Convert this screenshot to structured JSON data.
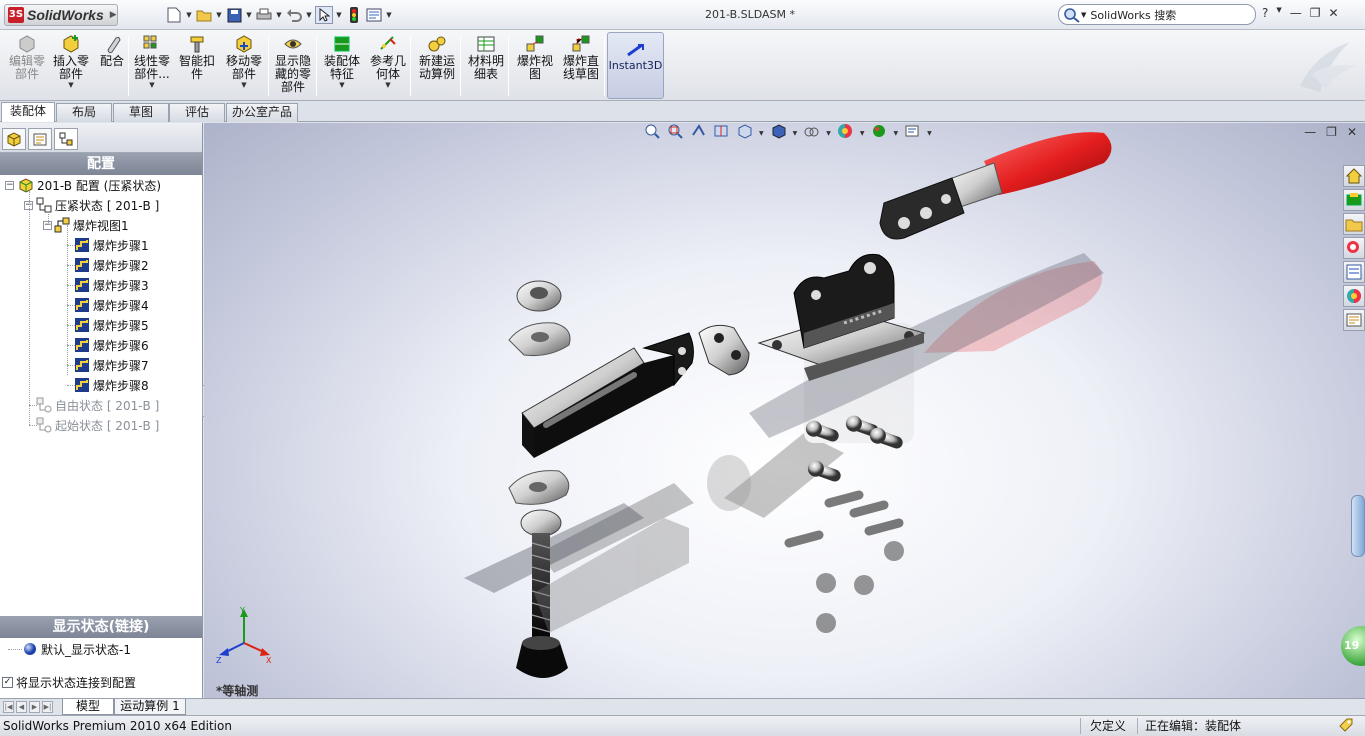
{
  "app": {
    "logo_text": "SolidWorks",
    "doc_title": "201-B.SLDASM *",
    "search_text": "SolidWorks 搜索",
    "help": "?"
  },
  "ribbon": {
    "buttons": [
      {
        "label": "编辑零\n部件"
      },
      {
        "label": "插入零\n部件"
      },
      {
        "label": "配合"
      },
      {
        "label": "线性零\n部件..."
      },
      {
        "label": "智能扣\n件"
      },
      {
        "label": "移动零\n部件"
      },
      {
        "label": "显示隐\n藏的零\n部件"
      },
      {
        "label": "装配体\n特征"
      },
      {
        "label": "参考几\n何体"
      },
      {
        "label": "新建运\n动算例"
      },
      {
        "label": "材料明\n细表"
      },
      {
        "label": "爆炸视\n图"
      },
      {
        "label": "爆炸直\n线草图"
      }
    ],
    "instant3d": "Instant3D"
  },
  "tabs": [
    "装配体",
    "布局",
    "草图",
    "评估",
    "办公室产品"
  ],
  "panel": {
    "config_header": "配置",
    "tree": [
      {
        "label": "201-B 配置  (压紧状态)",
        "level": 0
      },
      {
        "label": "压紧状态 [ 201-B ]",
        "level": 1
      },
      {
        "label": "爆炸视图1",
        "level": 2
      },
      {
        "label": "爆炸步骤1",
        "level": 3
      },
      {
        "label": "爆炸步骤2",
        "level": 3
      },
      {
        "label": "爆炸步骤3",
        "level": 3
      },
      {
        "label": "爆炸步骤4",
        "level": 3
      },
      {
        "label": "爆炸步骤5",
        "level": 3
      },
      {
        "label": "爆炸步骤6",
        "level": 3
      },
      {
        "label": "爆炸步骤7",
        "level": 3
      },
      {
        "label": "爆炸步骤8",
        "level": 3
      },
      {
        "label": "自由状态 [ 201-B ]",
        "level": 1
      },
      {
        "label": "起始状态 [ 201-B ]",
        "level": 1
      }
    ],
    "display_state_header": "显示状态(链接)",
    "display_state_item": "默认_显示状态-1",
    "link_checkbox": "将显示状态连接到配置",
    "link_checked": true
  },
  "viewport": {
    "view_name": "*等轴测",
    "triad": {
      "x": "X",
      "y": "Y",
      "z": "Z"
    },
    "badge": "19"
  },
  "bottom_tabs": [
    "模型",
    "运动算例 1"
  ],
  "status": {
    "edition": "SolidWorks Premium 2010 x64 Edition",
    "underdefined": "欠定义",
    "editing": "正在编辑：装配体"
  },
  "colors": {
    "handle_red": "#e41e1e",
    "accent_blue": "#1f3a8a",
    "panel_header": "#838b9b"
  }
}
